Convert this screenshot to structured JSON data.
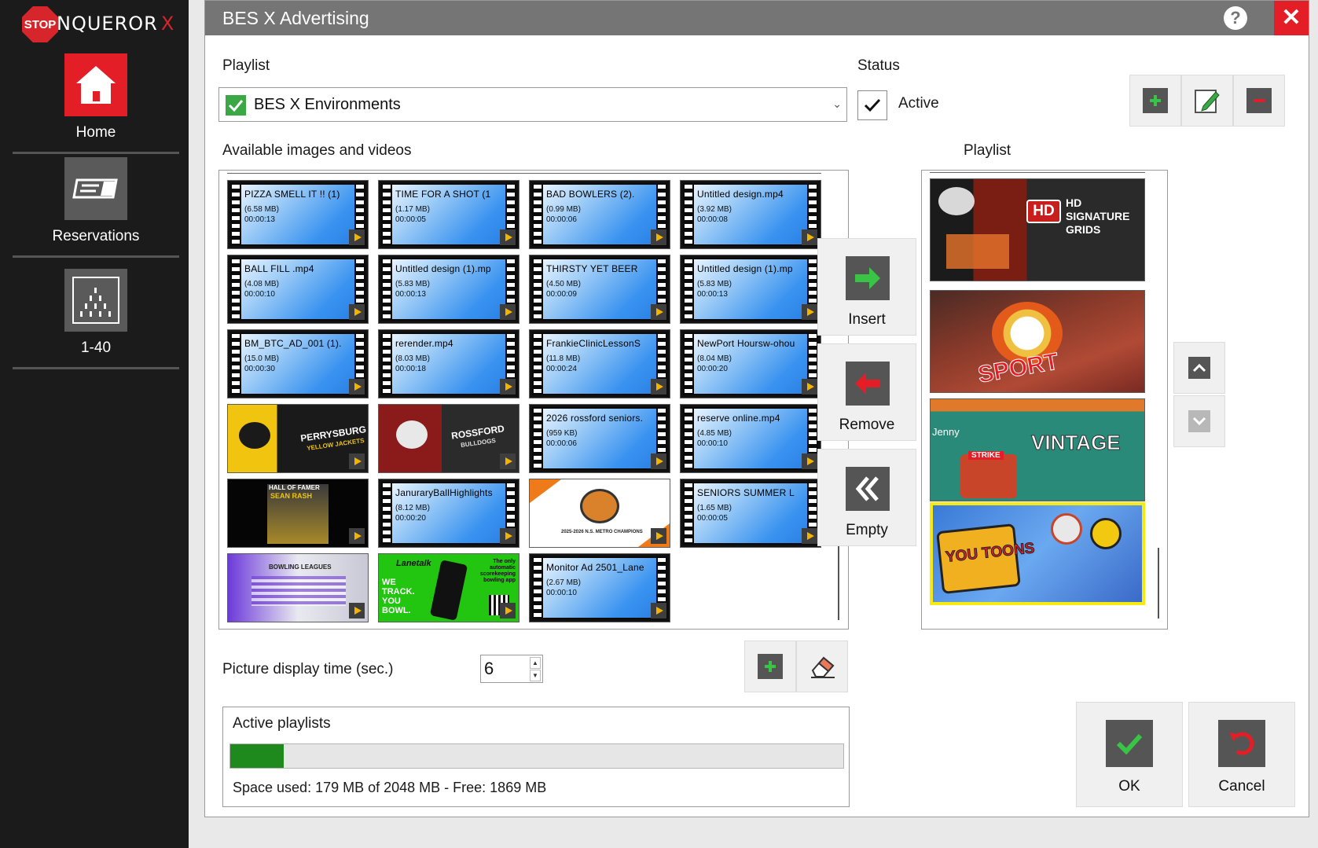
{
  "app": {
    "logo_text": "NQUEROR",
    "logo_accent": "X",
    "logo_stop": "STOP",
    "nav": [
      {
        "label": "Home",
        "icon": "house-icon"
      },
      {
        "label": "Reservations",
        "icon": "reservation-card-icon"
      },
      {
        "label": "1-40",
        "icon": "lanes-pins-icon"
      }
    ]
  },
  "dialog": {
    "title": "BES X Advertising",
    "help": "?",
    "close": "✕"
  },
  "playlist_section": {
    "label": "Playlist",
    "selected": "BES X Environments",
    "status_label": "Status",
    "status_value": "Active",
    "status_checked": true
  },
  "available": {
    "label": "Available images and videos",
    "items": [
      {
        "type": "video",
        "name": "PIZZA SMELL IT  !! (1)",
        "size": "(6.58 MB)",
        "duration": "00:00:13"
      },
      {
        "type": "video",
        "name": "TIME FOR A SHOT  (1",
        "size": "(1.17 MB)",
        "duration": "00:00:05"
      },
      {
        "type": "video",
        "name": "BAD  BOWLERS  (2).",
        "size": "(0.99 MB)",
        "duration": "00:00:06"
      },
      {
        "type": "video",
        "name": "Untitled design.mp4",
        "size": "(3.92 MB)",
        "duration": "00:00:08"
      },
      {
        "type": "video",
        "name": "BALL FILL .mp4",
        "size": "(4.08 MB)",
        "duration": "00:00:10"
      },
      {
        "type": "video",
        "name": "Untitled  design (1).mp",
        "size": "(5.83 MB)",
        "duration": "00:00:13"
      },
      {
        "type": "video",
        "name": "THIRSTY YET BEER",
        "size": "(4.50 MB)",
        "duration": "00:00:09"
      },
      {
        "type": "video",
        "name": "Untitled  design (1).mp",
        "size": "(5.83 MB)",
        "duration": "00:00:13"
      },
      {
        "type": "video",
        "name": "BM_BTC_AD_001 (1).",
        "size": "(15.0 MB)",
        "duration": "00:00:30"
      },
      {
        "type": "video",
        "name": "rerender.mp4",
        "size": "(8.03 MB)",
        "duration": "00:00:18"
      },
      {
        "type": "video",
        "name": "FrankieClinicLessonS",
        "size": "(11.8 MB)",
        "duration": "00:00:24"
      },
      {
        "type": "video",
        "name": "NewPort  Hoursw-ohou",
        "size": "(8.04 MB)",
        "duration": "00:00:20"
      },
      {
        "type": "image",
        "style": "perrysburg",
        "text": "PERRYSBURG",
        "sub": "YELLOW JACKETS"
      },
      {
        "type": "image",
        "style": "rossford",
        "text": "ROSSFORD",
        "sub": "BULLDOGS"
      },
      {
        "type": "video",
        "name": "2026  rossford seniors.",
        "size": "(959 KB)",
        "duration": "00:00:06"
      },
      {
        "type": "video",
        "name": "reserve online.mp4",
        "size": "(4.85 MB)",
        "duration": "00:00:10"
      },
      {
        "type": "image",
        "style": "hof",
        "text": "HALL OF FAMER",
        "sub": "SEAN RASH"
      },
      {
        "type": "video",
        "name": "JanuraryBallHighlights",
        "size": "(8.12 MB)",
        "duration": "00:00:20"
      },
      {
        "type": "image",
        "style": "tiger",
        "text": "2025-2026 N.S. METRO CHAMPIONS",
        "sub": ""
      },
      {
        "type": "video",
        "name": "SENIORS  SUMMER L",
        "size": "(1.65 MB)",
        "duration": "00:00:05"
      },
      {
        "type": "image",
        "style": "bowling",
        "text": "BOWLING LEAGUES",
        "sub": ""
      },
      {
        "type": "image",
        "style": "lanetalk",
        "text": "Lanetalk",
        "sub": "WE TRACK. YOU BOWL.",
        "tag": "The only automatic scorekeeping bowling app"
      },
      {
        "type": "video",
        "name": "Monitor Ad 2501_Lane",
        "size": "(2.67 MB)",
        "duration": "00:00:10"
      }
    ]
  },
  "actions": {
    "insert": "Insert",
    "remove": "Remove",
    "empty": "Empty"
  },
  "playlist": {
    "label": "Playlist",
    "items": [
      {
        "title": "HD SIGNATURE GRIDS",
        "style": "grids"
      },
      {
        "title": "SPORT",
        "style": "sport"
      },
      {
        "title": "VINTAGE",
        "style": "vintage",
        "tag": "STRIKE",
        "names": "Jenny"
      },
      {
        "title": "YOU TOONS",
        "style": "toons",
        "selected": true
      }
    ]
  },
  "picture_time": {
    "label": "Picture display time (sec.)",
    "value": "6"
  },
  "active_playlists": {
    "label": "Active playlists",
    "used_fraction": 0.087,
    "space_text": "Space used: 179 MB of 2048 MB - Free: 1869 MB"
  },
  "footer": {
    "ok": "OK",
    "cancel": "Cancel"
  },
  "colors": {
    "accent_red": "#e41e26",
    "green": "#39a845",
    "progress": "#1e8a1e",
    "selection": "#f6ea12"
  }
}
